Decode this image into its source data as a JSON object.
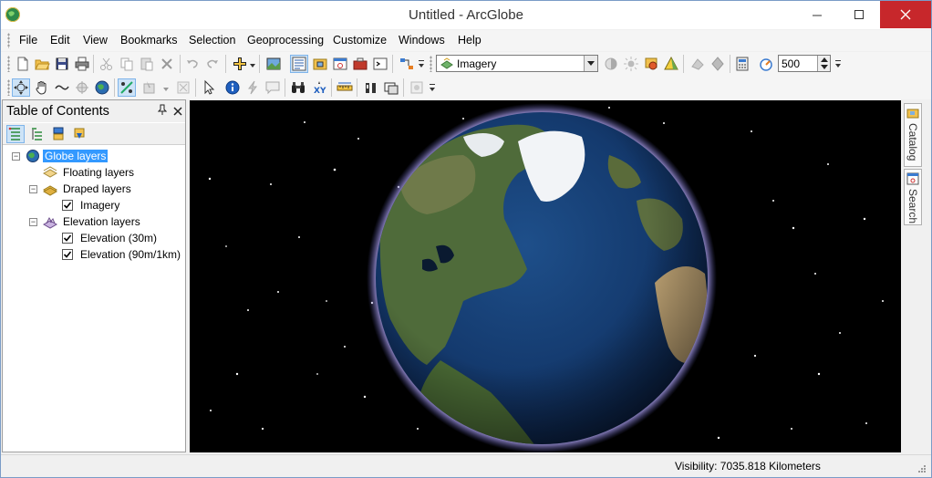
{
  "window": {
    "title": "Untitled - ArcGlobe"
  },
  "menu": [
    "File",
    "Edit",
    "View",
    "Bookmarks",
    "Selection",
    "Geoprocessing",
    "Customize",
    "Windows",
    "Help"
  ],
  "toolbar": {
    "layer_combo_value": "Imagery",
    "scale_combo_value": "500"
  },
  "toc": {
    "title": "Table of Contents",
    "globe_layers": "Globe layers",
    "floating_layers": "Floating layers",
    "draped_layers": "Draped layers",
    "imagery": "Imagery",
    "elevation_layers": "Elevation layers",
    "elevation_30m": "Elevation (30m)",
    "elevation_90m": "Elevation (90m/1km)"
  },
  "dock": {
    "catalog": "Catalog",
    "search": "Search"
  },
  "status": {
    "visibility": "Visibility:  7035.818 Kilometers"
  },
  "colors": {
    "selection": "#3399ff",
    "close": "#c7272b",
    "space": "#000000"
  }
}
